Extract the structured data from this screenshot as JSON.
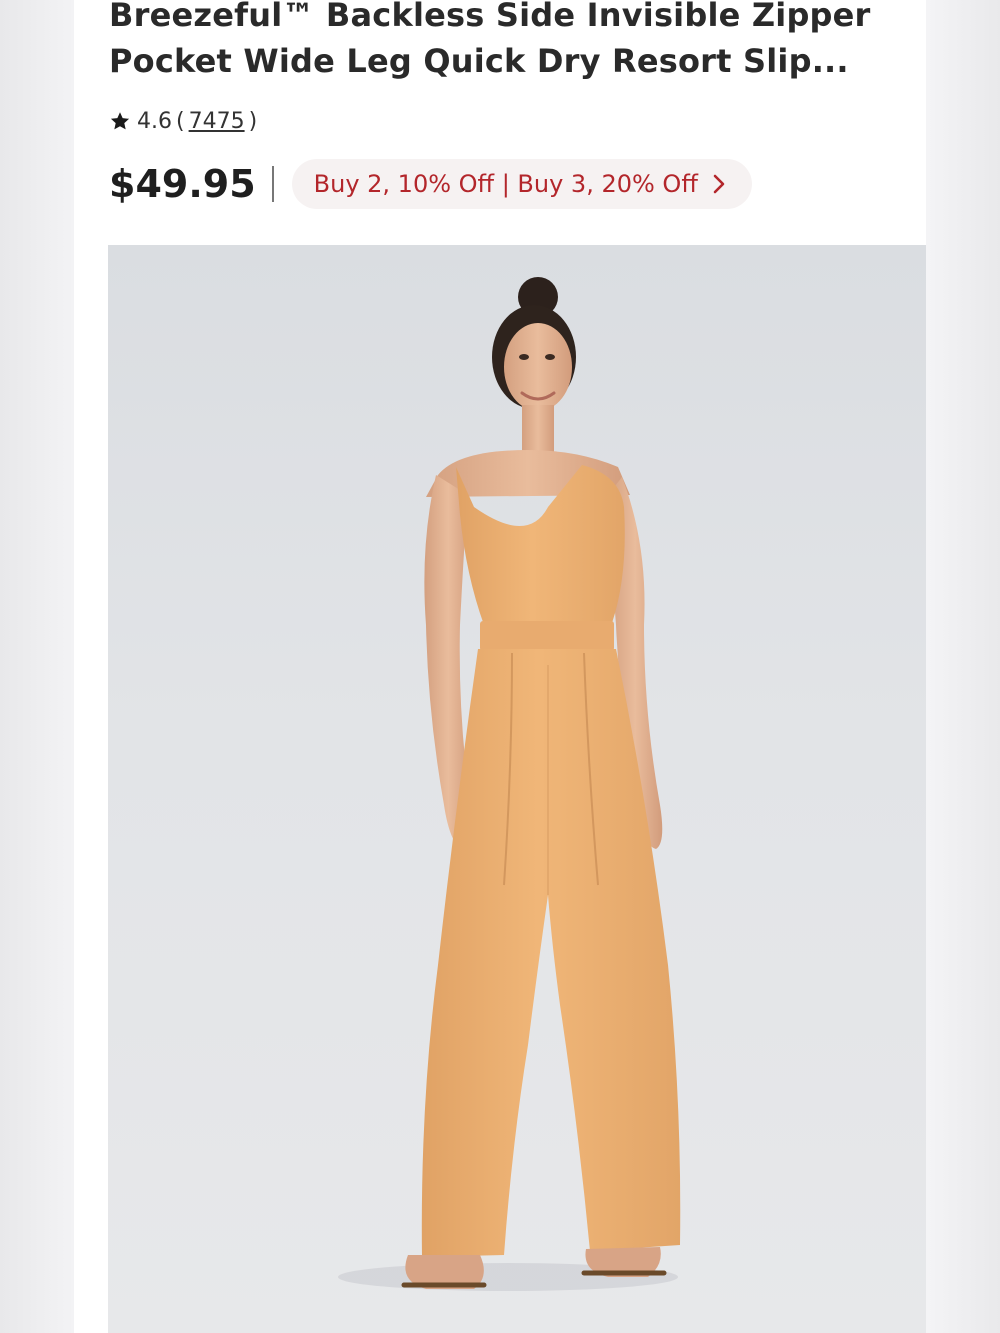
{
  "product": {
    "title": "Breezeful™ Backless Side Invisible Zipper Pocket Wide Leg Quick Dry Resort Slip...",
    "rating": "4.6",
    "paren_open": "(",
    "review_count": "7475",
    "paren_close": ")",
    "price": "$49.95",
    "promo": "Buy 2, 10% Off | Buy 3, 20% Off",
    "image": {
      "subject": "model in sleeveless wide-leg jumpsuit",
      "garment_color": "#eeb274",
      "background_color": "#dfe1e4"
    }
  },
  "colors": {
    "promo_text": "#b3262b",
    "promo_bg": "#f6f2f2",
    "price_text": "#1f1f1f"
  },
  "icons": {
    "rating": "star-icon",
    "promo": "chevron-right-icon"
  }
}
